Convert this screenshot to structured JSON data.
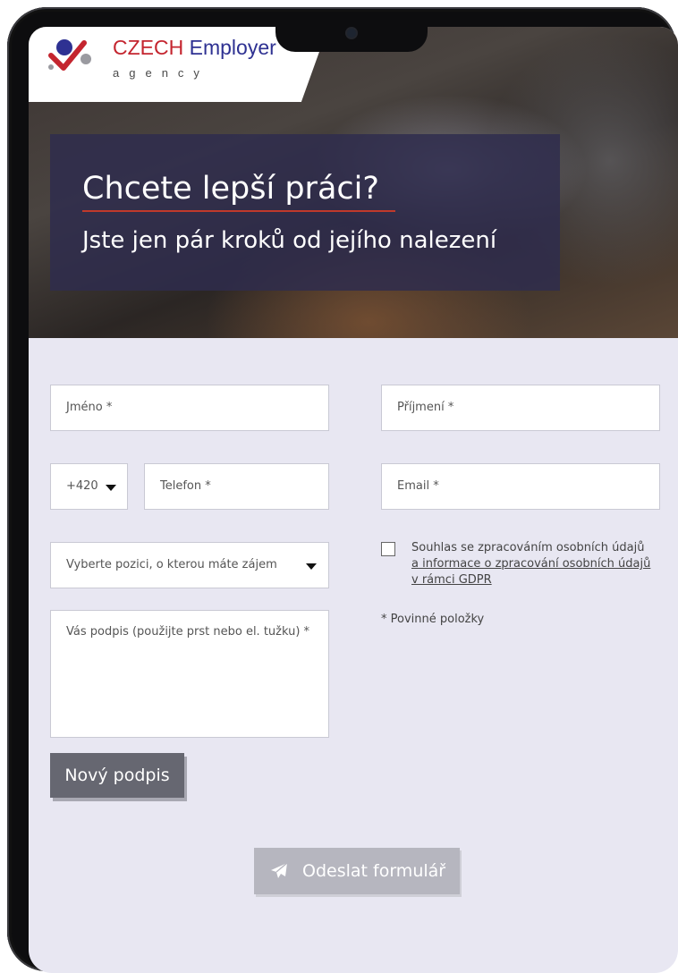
{
  "brand": {
    "name_red": "CZECH",
    "name_blue": "Employer",
    "sub": "agency",
    "colors": {
      "red": "#c4252f",
      "blue": "#2e3192",
      "grey": "#9a9aa0"
    }
  },
  "hero": {
    "title": "Chcete lepší práci?",
    "subtitle": "Jste jen pár kroků od jejího nalezení"
  },
  "form": {
    "first_name_placeholder": "Jméno *",
    "last_name_placeholder": "Příjmení *",
    "country_code": "+420",
    "phone_placeholder": "Telefon *",
    "email_placeholder": "Email *",
    "position_placeholder": "Vyberte pozici, o kterou máte zájem",
    "signature_placeholder": "Vás podpis (použijte prst nebo el. tužku) *",
    "consent_line1": "Souhlas se zpracováním osobních údajů",
    "consent_link1": "a informace o zpracování osobních údajů",
    "consent_link2": "v rámci GDPR",
    "consent_checked": false,
    "required_note": "* Povinné položky",
    "new_signature_label": "Nový podpis",
    "submit_label": "Odeslat formulář"
  },
  "icons": {
    "logo": "checkmark-dots-logo",
    "dropdown": "caret-down-icon",
    "submit": "paper-plane-icon"
  }
}
